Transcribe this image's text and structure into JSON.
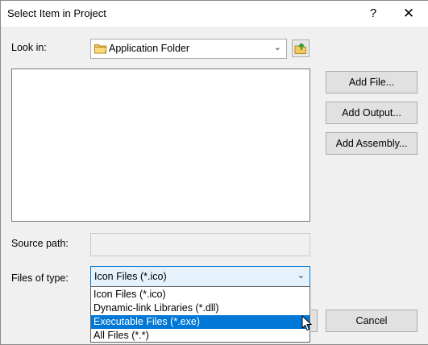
{
  "window": {
    "title": "Select Item in Project",
    "help_label": "?",
    "close_label": "✕"
  },
  "look_in": {
    "label": "Look in:",
    "value": "Application Folder"
  },
  "buttons": {
    "add_file": "Add File...",
    "add_output": "Add Output...",
    "add_assembly": "Add Assembly...",
    "ok": "",
    "cancel": "Cancel"
  },
  "source_path": {
    "label": "Source path:",
    "value": ""
  },
  "files_of_type": {
    "label": "Files of type:",
    "value": "Icon Files (*.ico)",
    "options": [
      "Icon Files (*.ico)",
      "Dynamic-link Libraries (*.dll)",
      "Executable Files (*.exe)",
      "All Files (*.*)"
    ],
    "highlighted_index": 2
  },
  "icons": [
    "folder-icon",
    "up-folder-icon",
    "chevron-down-icon",
    "mouse-pointer-icon"
  ]
}
